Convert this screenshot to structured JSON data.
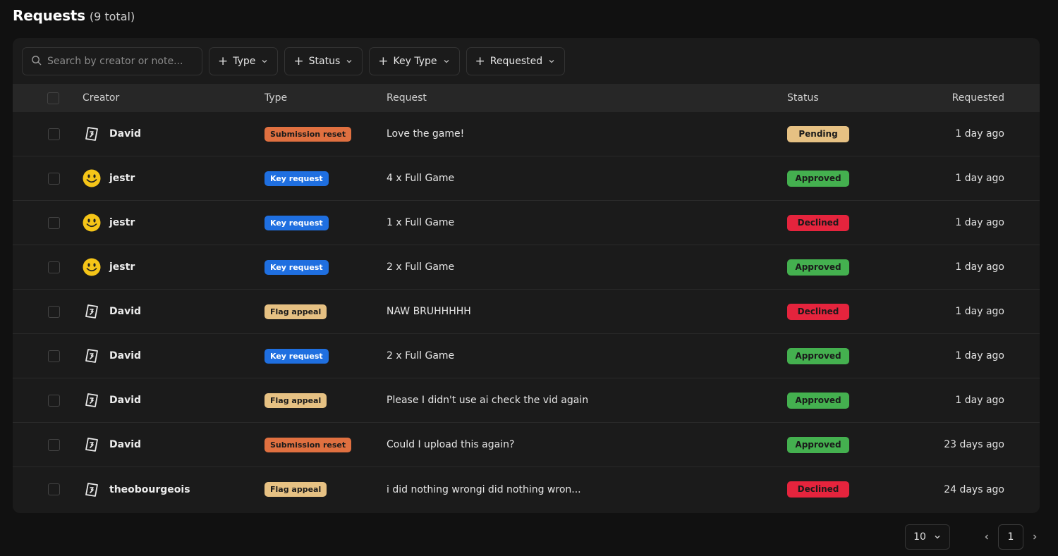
{
  "header": {
    "title": "Requests",
    "count": "(9 total)"
  },
  "search": {
    "placeholder": "Search by creator or note..."
  },
  "filters": [
    {
      "label": "Type"
    },
    {
      "label": "Status"
    },
    {
      "label": "Key Type"
    },
    {
      "label": "Requested"
    }
  ],
  "columns": {
    "creator": "Creator",
    "type": "Type",
    "request": "Request",
    "status": "Status",
    "requested": "Requested"
  },
  "type_colors": {
    "Submission reset": {
      "bg": "#e07040",
      "fg": "#1a1a1a"
    },
    "Key request": {
      "bg": "#1f6fe0",
      "fg": "#ffffff"
    },
    "Flag appeal": {
      "bg": "#e6c183",
      "fg": "#1a1a1a"
    }
  },
  "status_colors": {
    "Pending": {
      "bg": "#e6c183",
      "fg": "#1a1a1a"
    },
    "Approved": {
      "bg": "#44b04f",
      "fg": "#1a1a1a"
    },
    "Declined": {
      "bg": "#e5243d",
      "fg": "#1a1a1a"
    }
  },
  "rows": [
    {
      "creator": "David",
      "avatar": "logo-icon",
      "type": "Submission reset",
      "request": "Love the game!",
      "status": "Pending",
      "requested": "1 day ago"
    },
    {
      "creator": "jestr",
      "avatar": "smiley-icon",
      "type": "Key request",
      "request": "4 x Full Game",
      "status": "Approved",
      "requested": "1 day ago"
    },
    {
      "creator": "jestr",
      "avatar": "smiley-icon",
      "type": "Key request",
      "request": "1 x Full Game",
      "status": "Declined",
      "requested": "1 day ago"
    },
    {
      "creator": "jestr",
      "avatar": "smiley-icon",
      "type": "Key request",
      "request": "2 x Full Game",
      "status": "Approved",
      "requested": "1 day ago"
    },
    {
      "creator": "David",
      "avatar": "logo-icon",
      "type": "Flag appeal",
      "request": "NAW BRUHHHHH",
      "status": "Declined",
      "requested": "1 day ago"
    },
    {
      "creator": "David",
      "avatar": "logo-icon",
      "type": "Key request",
      "request": "2 x Full Game",
      "status": "Approved",
      "requested": "1 day ago"
    },
    {
      "creator": "David",
      "avatar": "logo-icon",
      "type": "Flag appeal",
      "request": "Please I didn't use ai check the vid again",
      "status": "Approved",
      "requested": "1 day ago"
    },
    {
      "creator": "David",
      "avatar": "logo-icon",
      "type": "Submission reset",
      "request": "Could I upload this again?",
      "status": "Approved",
      "requested": "23 days ago"
    },
    {
      "creator": "theobourgeois",
      "avatar": "logo-icon",
      "type": "Flag appeal",
      "request": "i did nothing wrongi did nothing wron...",
      "status": "Declined",
      "requested": "24 days ago"
    }
  ],
  "pagination": {
    "page_size": "10",
    "current_page": "1"
  }
}
